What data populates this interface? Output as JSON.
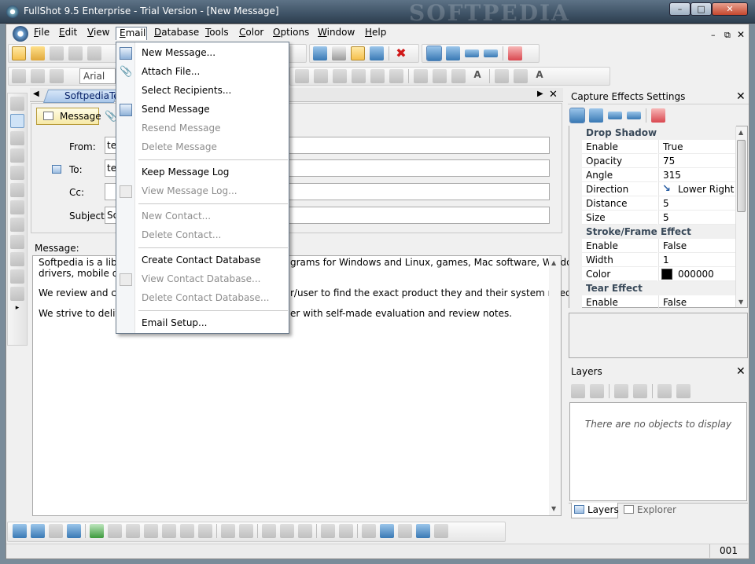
{
  "window": {
    "title": "FullShot 9.5 Enterprise - Trial Version - [New Message]",
    "watermark": "SOFTPEDIA"
  },
  "menubar": {
    "items": [
      {
        "label": "File",
        "u": "F",
        "rest": "ile"
      },
      {
        "label": "Edit",
        "u": "E",
        "rest": "dit"
      },
      {
        "label": "View",
        "u": "V",
        "rest": "iew"
      },
      {
        "label": "Email",
        "u": "E",
        "rest": "mail"
      },
      {
        "label": "Database",
        "u": "D",
        "rest": "atabase"
      },
      {
        "label": "Tools",
        "u": "T",
        "rest": "ools"
      },
      {
        "label": "Color",
        "u": "C",
        "rest": "olor"
      },
      {
        "label": "Options",
        "u": "O",
        "rest": "ptions"
      },
      {
        "label": "Window",
        "u": "W",
        "rest": "indow"
      },
      {
        "label": "Help",
        "u": "H",
        "rest": "elp"
      }
    ]
  },
  "format_toolbar": {
    "font_name": "Arial"
  },
  "email_menu": {
    "new_message": "New Message...",
    "attach_file": "Attach File...",
    "select_recipients": "Select Recipients...",
    "send_message": "Send Message",
    "resend_message": "Resend Message",
    "delete_message": "Delete Message",
    "keep_message_log": "Keep Message Log",
    "view_message_log": "View Message Log...",
    "new_contact": "New Contact...",
    "delete_contact": "Delete Contact...",
    "create_contact_database": "Create Contact Database",
    "view_contact_database": "View Contact Database...",
    "delete_contact_database": "Delete Contact Database...",
    "email_setup": "Email Setup..."
  },
  "document": {
    "tab_label": "SoftpediaTe",
    "message_tab": "Message",
    "from_label": "From:",
    "from_value": "te",
    "to_label": "To:",
    "to_value": "te",
    "cc_label": "Cc:",
    "subject_label": "Subject:",
    "subject_value": "So",
    "message_label": "Message:",
    "body_line1_left": "Softpedia is a library c",
    "body_line1_right": "grams for Windows and Linux, games, Mac software, Windows",
    "body_line2_left": "drivers, mobile device",
    "body_line3_left": "We review and categ",
    "body_line3_right": "r/user to find the exact product they and their system needs.",
    "body_line4_left": "We strive to deliver o",
    "body_line4_right": "er with self-made evaluation and review notes."
  },
  "capture_effects": {
    "title": "Capture Effects Settings",
    "categories": {
      "drop_shadow": "Drop Shadow",
      "stroke_frame": "Stroke/Frame Effect",
      "tear": "Tear Effect"
    },
    "rows": {
      "ds_enable": {
        "name": "Enable",
        "value": "True"
      },
      "ds_opacity": {
        "name": "Opacity",
        "value": "75"
      },
      "ds_angle": {
        "name": "Angle",
        "value": "315"
      },
      "ds_direction": {
        "name": "Direction",
        "value": "Lower Right"
      },
      "ds_distance": {
        "name": "Distance",
        "value": "5"
      },
      "ds_size": {
        "name": "Size",
        "value": "5"
      },
      "sf_enable": {
        "name": "Enable",
        "value": "False"
      },
      "sf_width": {
        "name": "Width",
        "value": "1"
      },
      "sf_color": {
        "name": "Color",
        "value": "000000"
      },
      "te_enable": {
        "name": "Enable",
        "value": "False"
      }
    },
    "stroke_color_hex": "#000000"
  },
  "layers": {
    "title": "Layers",
    "empty_text": "There are no objects to display",
    "tab_layers": "Layers",
    "tab_explorer": "Explorer"
  },
  "status": {
    "number": "001"
  }
}
